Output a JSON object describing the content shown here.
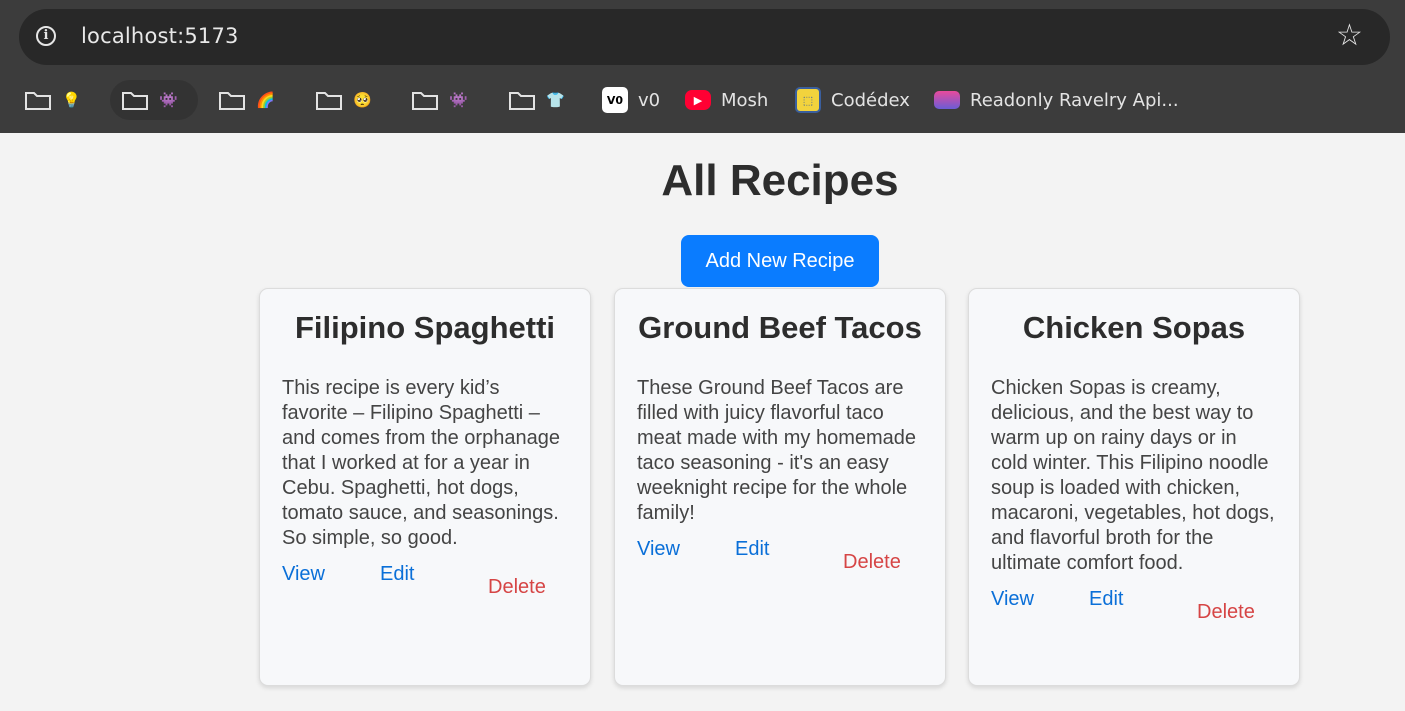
{
  "browser": {
    "url": "localhost:5173",
    "bookmarks": [
      {
        "type": "folder",
        "emoji": "💡"
      },
      {
        "type": "folder",
        "emoji": "👾"
      },
      {
        "type": "folder",
        "emoji": "🌈"
      },
      {
        "type": "folder",
        "emoji": "🥺"
      },
      {
        "type": "folder",
        "emoji": "👾"
      },
      {
        "type": "folder",
        "emoji": "👕"
      },
      {
        "type": "link",
        "label": "v0",
        "icon": "v0-icon"
      },
      {
        "type": "link",
        "label": "Mosh",
        "icon": "youtube-icon"
      },
      {
        "type": "link",
        "label": "Codédex",
        "icon": "codedex-icon"
      },
      {
        "type": "link",
        "label": "Readonly Ravelry Api...",
        "icon": "ravelry-icon"
      }
    ]
  },
  "page": {
    "title": "All Recipes",
    "add_button": "Add New Recipe",
    "recipes": [
      {
        "title": "Filipino Spaghetti",
        "description": "This recipe is every kid’s favorite – Filipino Spaghetti – and comes from the orphanage that I worked at for a year in Cebu. Spaghetti, hot dogs, tomato sauce, and seasonings. So simple, so good.",
        "view": "View",
        "edit": "Edit",
        "delete": "Delete"
      },
      {
        "title": "Ground Beef Tacos",
        "description": "These Ground Beef Tacos are filled with juicy flavorful taco meat made with my homemade taco seasoning - it's an easy weeknight recipe for the whole family!",
        "view": "View",
        "edit": "Edit",
        "delete": "Delete"
      },
      {
        "title": "Chicken Sopas",
        "description": "Chicken Sopas is creamy, delicious, and the best way to warm up on rainy days or in cold winter. This Filipino noodle soup is loaded with chicken, macaroni, vegetables, hot dogs, and flavorful broth for the ultimate comfort food.",
        "view": "View",
        "edit": "Edit",
        "delete": "Delete"
      }
    ]
  },
  "colors": {
    "accent": "#0a7cff",
    "link": "#0a6fd8",
    "danger": "#d64545",
    "page_bg": "#f3f3f3",
    "card_bg": "#f7f8fa"
  }
}
